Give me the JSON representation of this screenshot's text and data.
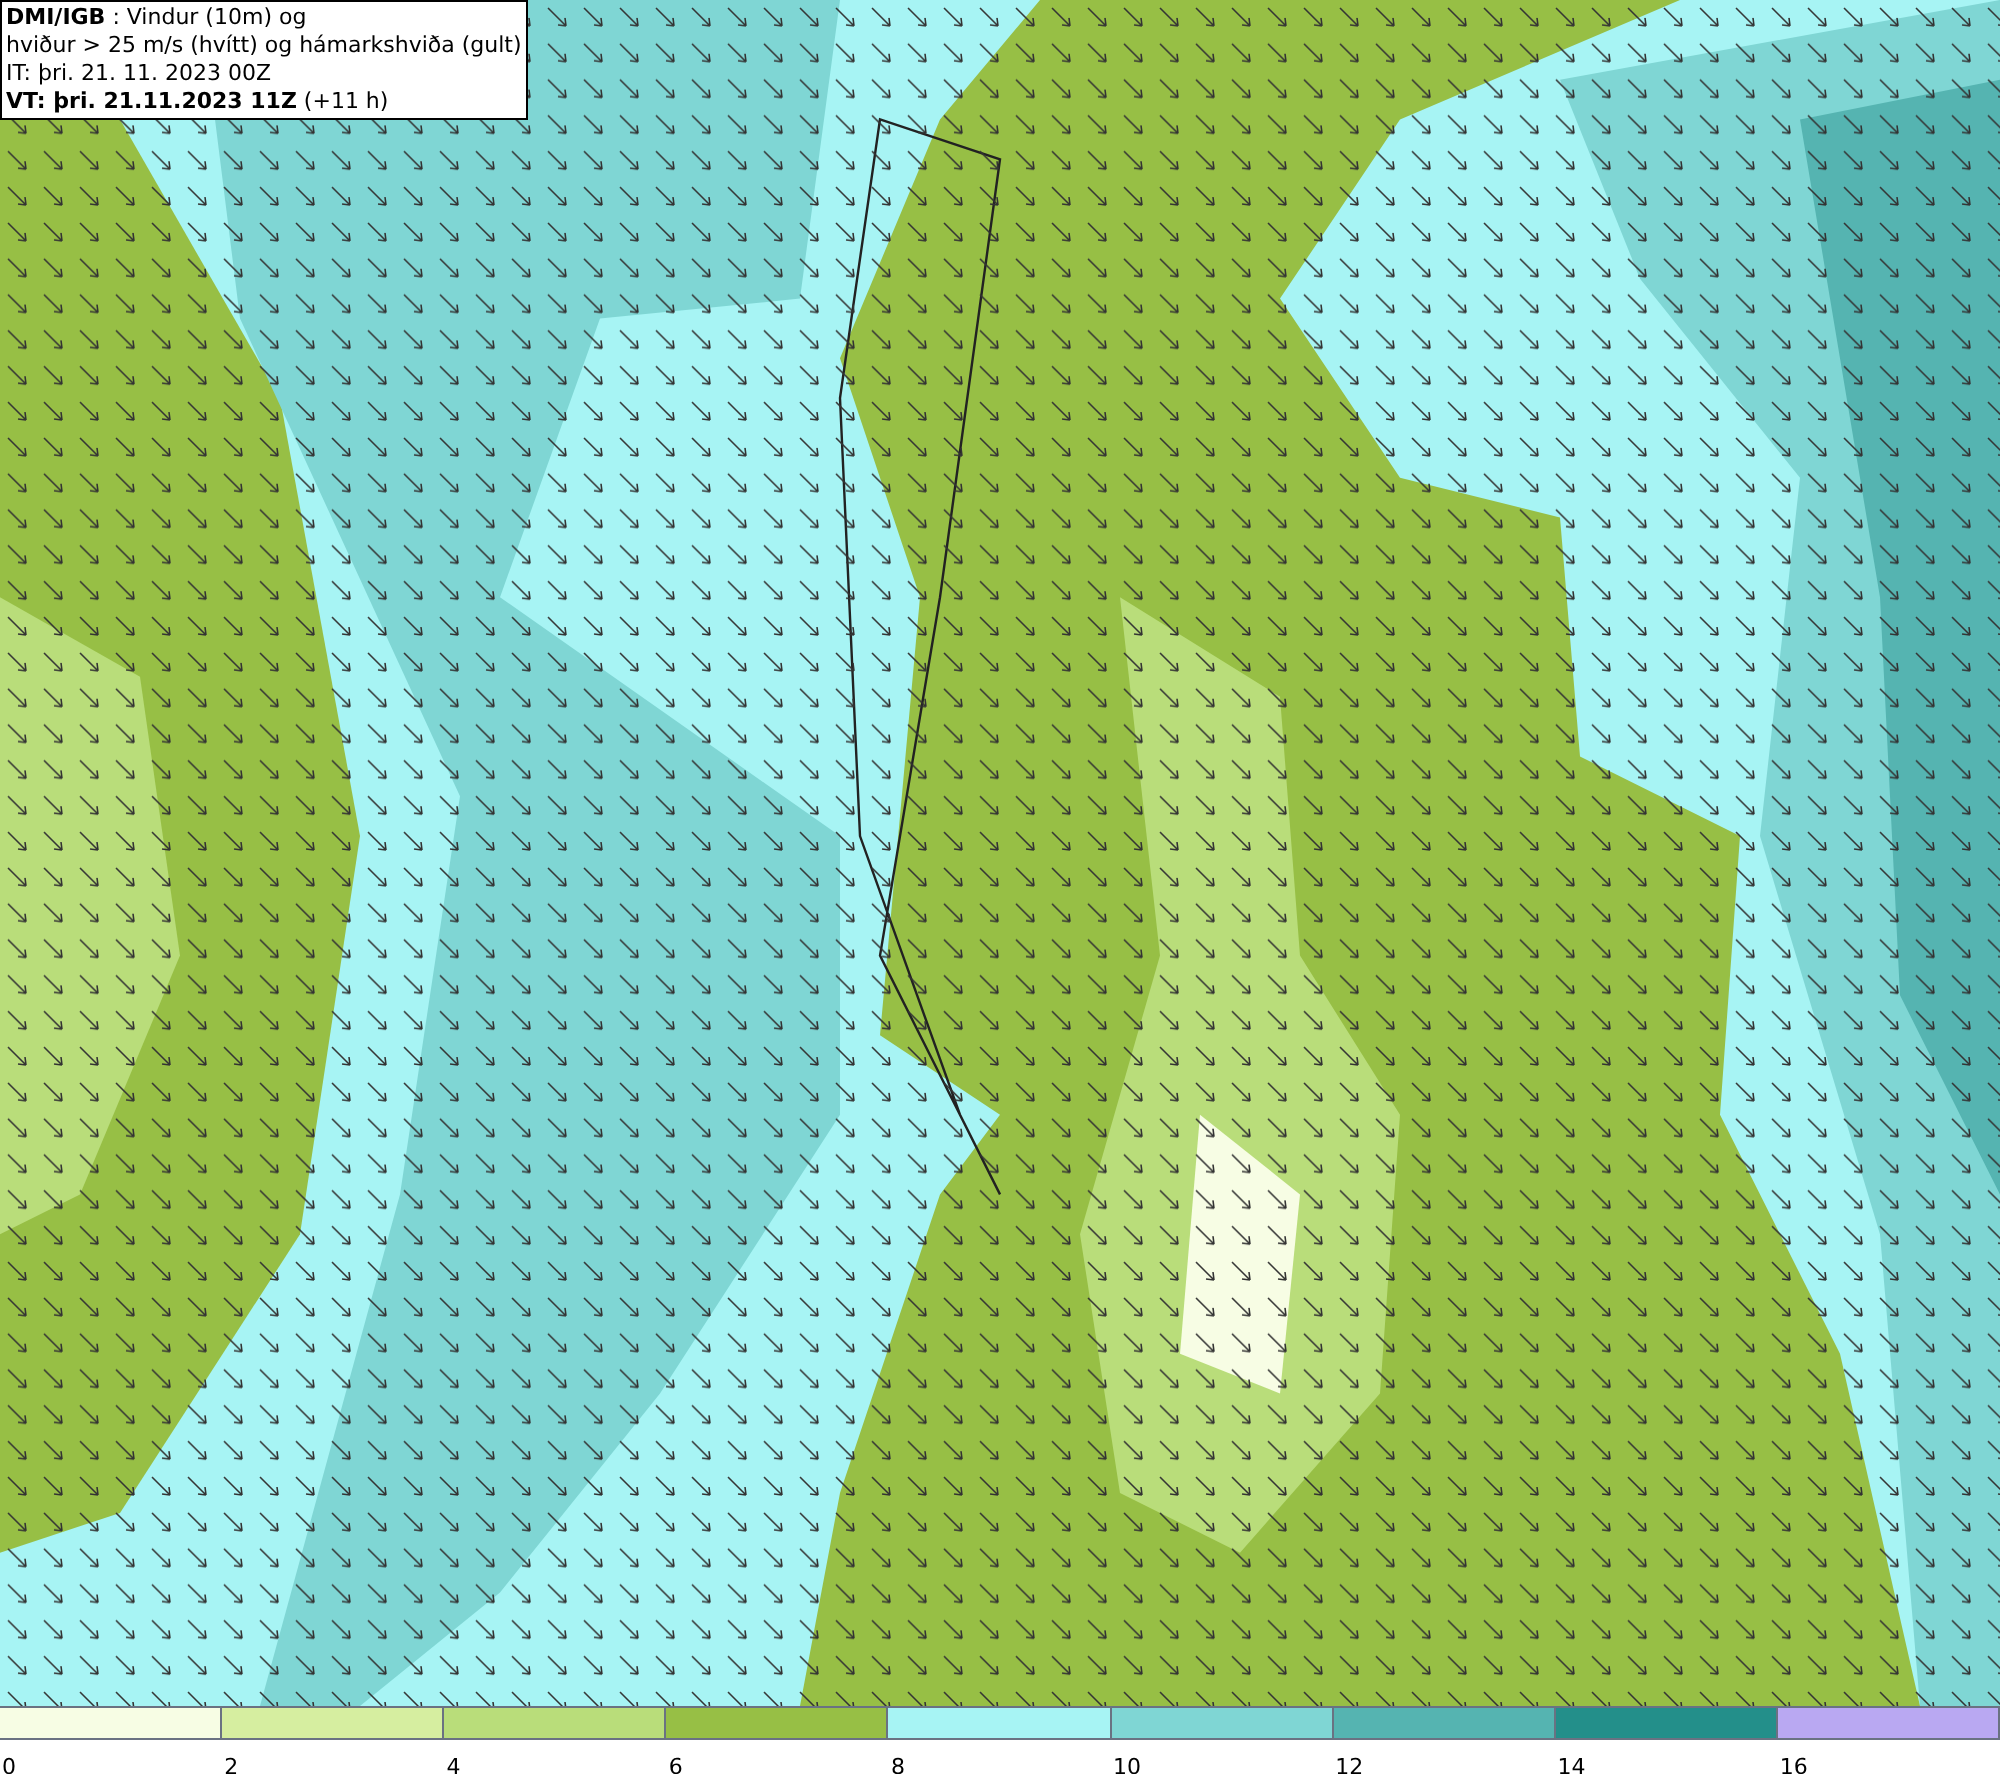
{
  "info_box": {
    "lines": [
      "**DMI/IGB** : Vindur (10m) og",
      "hviður > 25 m/s (hvítt) og hámarkshviða (gult)",
      "IT: þri. 21. 11. 2023 00Z",
      "**VT: þri. 21.11.2023 11Z** (+11 h)"
    ]
  },
  "legend": {
    "bins": [
      {
        "label": "0",
        "color": "#f7fde4"
      },
      {
        "label": "2",
        "color": "#d6eea0"
      },
      {
        "label": "4",
        "color": "#b9dd7a"
      },
      {
        "label": "6",
        "color": "#97bf45"
      },
      {
        "label": "8",
        "color": "#a7f4f4"
      },
      {
        "label": "10",
        "color": "#7fd6d4"
      },
      {
        "label": "12",
        "color": "#55b4b1"
      },
      {
        "label": "14",
        "color": "#238f8a"
      },
      {
        "label": "16",
        "color": "#b9a8f2"
      }
    ]
  }
}
